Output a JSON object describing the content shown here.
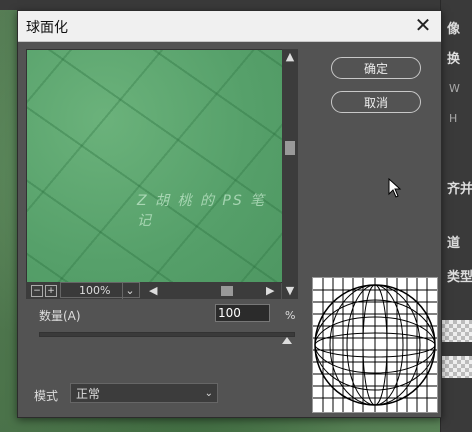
{
  "background": {
    "right_panel": {
      "label_1": "像",
      "label_2": "换",
      "small_w": "W",
      "small_h": "H",
      "label_3": "齐并",
      "label_4": "道",
      "label_5": "类型"
    }
  },
  "dialog": {
    "title": "球面化",
    "close_glyph": "✕",
    "ok_label": "确定",
    "cancel_label": "取消",
    "preview": {
      "watermark": "Z 胡 桃 的 PS 笔 记",
      "zoom_value": "100%",
      "zoom_out_glyph": "−",
      "zoom_in_glyph": "+"
    },
    "amount": {
      "label": "数量(A)",
      "value": "100",
      "unit": "%",
      "slider_fraction": 1.0
    },
    "mode": {
      "label": "模式",
      "value": "正常"
    }
  },
  "colors": {
    "dialog_bg": "#535353",
    "titlebar_bg": "#f0f0f0",
    "preview_green": "#56a06a"
  }
}
